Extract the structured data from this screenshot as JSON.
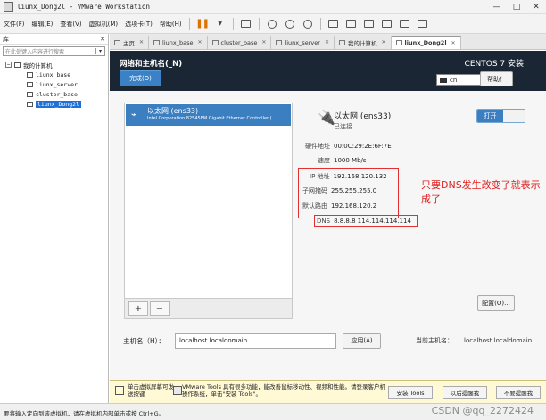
{
  "window": {
    "title": "liunx_Dong2l - VMware Workstation",
    "controls": [
      "—",
      "□",
      "✕"
    ]
  },
  "menu": [
    "文件(F)",
    "编辑(E)",
    "查看(V)",
    "虚拟机(M)",
    "选项卡(T)",
    "帮助(H)"
  ],
  "library": {
    "header": "库",
    "search_placeholder": "在此处键入内容进行搜索",
    "root": "我的计算机",
    "vms": [
      "liunx_base",
      "liunx_server",
      "cluster_base",
      "liunx_Dong2l"
    ]
  },
  "tabs": [
    "主页",
    "liunx_base",
    "cluster_base",
    "liunx_server",
    "我的计算机",
    "liunx_Dong2l"
  ],
  "installer": {
    "page_title": "网络和主机名(_N)",
    "done_button": "完成(D)",
    "product": "CENTOS 7 安装",
    "keyboard": "cn",
    "help_button": "帮助！",
    "device": {
      "name": "以太网 (ens33)",
      "description": "Intel Corporation 82545EM Gigabit Ethernet Controller (",
      "status": "已连接",
      "toggle": "打开"
    },
    "properties": [
      {
        "key": "硬件地址",
        "value": "00:0C:29:2E:6F:7E"
      },
      {
        "key": "速度",
        "value": "1000 Mb/s"
      },
      {
        "key": "IP 地址",
        "value": "192.168.120.132"
      },
      {
        "key": "子网掩码",
        "value": "255.255.255.0"
      },
      {
        "key": "默认路由",
        "value": "192.168.120.2"
      },
      {
        "key": "DNS",
        "value": "8.8.8.8 114.114.114.114"
      }
    ],
    "annotation": "只要DNS发生改变了就表示成了",
    "list_add": "+",
    "list_remove": "−",
    "config_button": "配置(O)...",
    "hostname_label": "主机名（H）：",
    "hostname_value": "localhost.localdomain",
    "apply_button": "应用(A)",
    "current_host_label": "当前主机名：",
    "current_host_value": "localhost.localdomain"
  },
  "vmtools": {
    "click_text": "单击虚拟屏幕可发送按键",
    "message": "VMware Tools 具有很多功能，能改善鼠标移动性、视频和性能。请登录客户机操作系统，单击\"安装 Tools\"。",
    "install_button": "安装 Tools",
    "later_button": "以后提醒我",
    "never_button": "不要提醒我"
  },
  "statusbar": {
    "text": "要将输入定向到该虚拟机，请在虚拟机内部单击或按 Ctrl+G。",
    "watermark": "CSDN @qq_2272424"
  }
}
